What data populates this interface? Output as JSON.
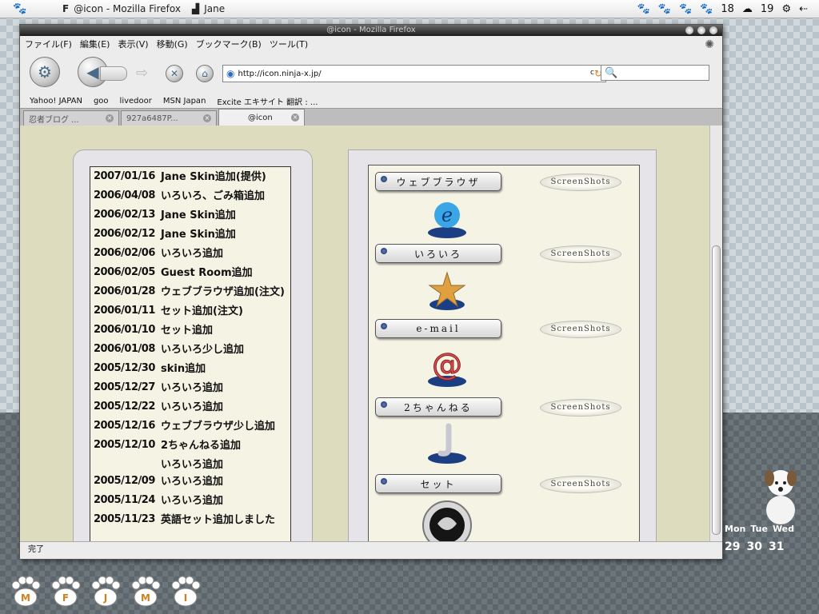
{
  "panel": {
    "tasks": [
      {
        "label": "@icon - Mozilla Firefox"
      },
      {
        "label": "Jane"
      }
    ],
    "tray_num1": "18",
    "tray_num2": "19"
  },
  "window": {
    "title": "@icon - Mozilla Firefox",
    "menu": [
      "ファイル(F)",
      "編集(E)",
      "表示(V)",
      "移動(G)",
      "ブックマーク(B)",
      "ツール(T)"
    ],
    "url": "http://icon.ninja-x.jp/",
    "url_extra": "c",
    "bookmarks": [
      "Yahoo! JAPAN",
      "goo",
      "livedoor",
      "MSN Japan",
      "Excite エキサイト 翻訳 : ..."
    ],
    "tabs": [
      {
        "label": "忍者ブログ ..."
      },
      {
        "label": "927a6487P..."
      },
      {
        "label": "@icon"
      }
    ],
    "status": "完了"
  },
  "news": [
    {
      "date": "2007/01/16",
      "text": "Jane Skin追加(提供)"
    },
    {
      "date": "2006/04/08",
      "text": "いろいろ、ごみ箱追加"
    },
    {
      "date": "2006/02/13",
      "text": "Jane Skin追加"
    },
    {
      "date": "2006/02/12",
      "text": "Jane Skin追加"
    },
    {
      "date": "2006/02/06",
      "text": "いろいろ追加"
    },
    {
      "date": "2006/02/05",
      "text": "Guest Room追加"
    },
    {
      "date": "2006/01/28",
      "text": "ウェブブラウザ追加(注文)"
    },
    {
      "date": "2006/01/11",
      "text": "セット追加(注文)"
    },
    {
      "date": "2006/01/10",
      "text": "セット追加"
    },
    {
      "date": "2006/01/08",
      "text": "いろいろ少し追加"
    },
    {
      "date": "2005/12/30",
      "text": "skin追加"
    },
    {
      "date": "2005/12/27",
      "text": "いろいろ追加"
    },
    {
      "date": "2005/12/22",
      "text": "いろいろ追加"
    },
    {
      "date": "2005/12/16",
      "text": "ウェブブラウザ少し追加"
    },
    {
      "date": "2005/12/10",
      "text": "2ちゃんねる追加"
    },
    {
      "date": "",
      "text": "いろいろ追加"
    },
    {
      "date": "2005/12/09",
      "text": "いろいろ追加"
    },
    {
      "date": "2005/11/24",
      "text": "いろいろ追加"
    },
    {
      "date": "2005/11/23",
      "text": "英語セット追加しました"
    }
  ],
  "categories": [
    {
      "label": "ウェブブラウザ",
      "ss": "ScreenShots"
    },
    {
      "label": "いろいろ",
      "ss": "ScreenShots"
    },
    {
      "label": "e-mail",
      "ss": "ScreenShots"
    },
    {
      "label": "2ちゃんねる",
      "ss": "ScreenShots"
    },
    {
      "label": "セット",
      "ss": "ScreenShots"
    }
  ],
  "dock": [
    "M",
    "F",
    "J",
    "M",
    "I"
  ],
  "calendar": {
    "days": [
      "Mon",
      "Tue",
      "Wed"
    ],
    "dates": [
      "29",
      "30",
      "31"
    ]
  },
  "colors": {
    "accent": "#1f5fb0",
    "content_bg": "#dedcbe",
    "panel_bg": "#f5f3e4"
  }
}
